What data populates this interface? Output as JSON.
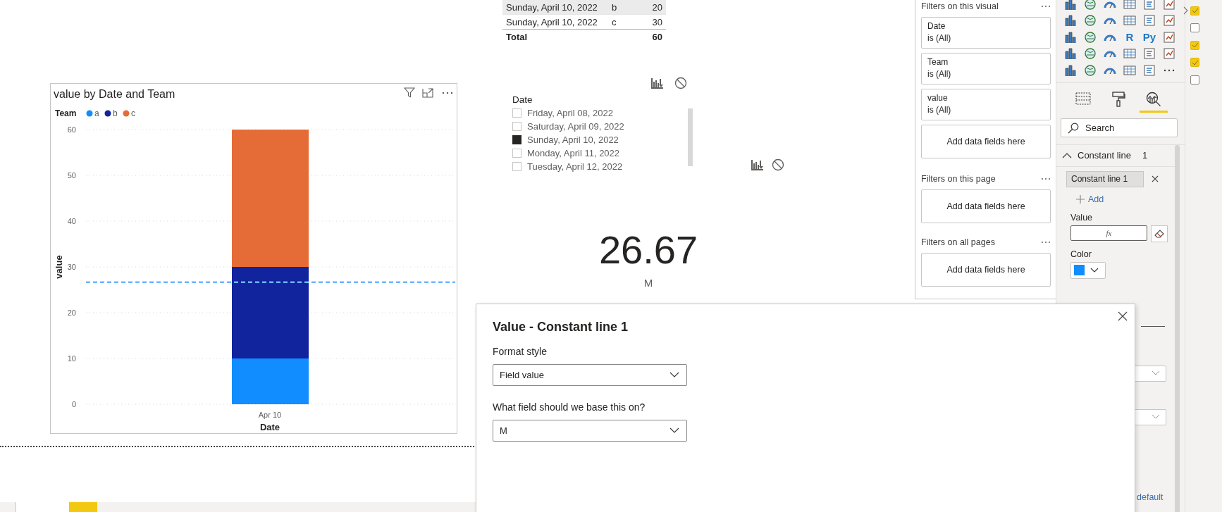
{
  "report": {
    "table": {
      "rows": [
        {
          "cells": [
            "Sunday, April 10, 2022",
            "b",
            "20"
          ],
          "selected": true
        },
        {
          "cells": [
            "Sunday, April 10, 2022",
            "c",
            "30"
          ],
          "selected": false
        }
      ],
      "total": [
        "Total",
        "60"
      ]
    },
    "slicer": {
      "title": "Date",
      "items": [
        {
          "label": "Friday, April 08, 2022",
          "checked": false
        },
        {
          "label": "Saturday, April 09, 2022",
          "checked": false
        },
        {
          "label": "Sunday, April 10, 2022",
          "checked": true
        },
        {
          "label": "Monday, April 11, 2022",
          "checked": false
        },
        {
          "label": "Tuesday, April 12, 2022",
          "checked": false
        }
      ]
    },
    "card": {
      "value": "26.67",
      "label": "M"
    },
    "chart": {
      "title": "value by Date and Team",
      "chart_data": {
        "type": "bar",
        "stacked": true,
        "grid": true,
        "legend": {
          "title": "Team"
        },
        "xlabel": "Date",
        "ylabel": "value",
        "categories": [
          "Apr 10"
        ],
        "series": [
          {
            "name": "a",
            "color": "#118dff",
            "values": [
              10
            ]
          },
          {
            "name": "b",
            "color": "#12239e",
            "values": [
              20
            ]
          },
          {
            "name": "c",
            "color": "#e66c37",
            "values": [
              30
            ]
          }
        ],
        "ylim": [
          0,
          60
        ],
        "yticks": [
          0,
          10,
          20,
          30,
          40,
          50,
          60
        ],
        "ref_lines": [
          {
            "axis": "y",
            "value": 26.67,
            "color": "#6cb6ff"
          }
        ]
      }
    },
    "page_tabs": [
      {
        "selected": false
      },
      {
        "selected": true
      }
    ]
  },
  "filters": {
    "sections": [
      {
        "title": "Filters on this visual",
        "cards": [
          {
            "field": "Date",
            "condition": "is (All)"
          },
          {
            "field": "Team",
            "condition": "is (All)"
          },
          {
            "field": "value",
            "condition": "is (All)"
          }
        ],
        "placeholder": "Add data fields here"
      },
      {
        "title": "Filters on this page",
        "placeholder": "Add data fields here"
      },
      {
        "title": "Filters on all pages",
        "placeholder": "Add data fields here"
      }
    ]
  },
  "visualizations": {
    "gallery": [
      {
        "kind": "icon"
      },
      {
        "kind": "icon"
      },
      {
        "kind": "icon"
      },
      {
        "kind": "icon"
      },
      {
        "kind": "icon"
      },
      {
        "kind": "icon"
      },
      {
        "kind": "icon"
      },
      {
        "kind": "icon"
      },
      {
        "kind": "icon"
      },
      {
        "kind": "icon"
      },
      {
        "kind": "icon"
      },
      {
        "kind": "icon"
      },
      {
        "kind": "icon"
      },
      {
        "kind": "icon"
      },
      {
        "kind": "icon"
      },
      {
        "kind": "letter",
        "text": "R"
      },
      {
        "kind": "letter",
        "text": "Py"
      },
      {
        "kind": "icon"
      },
      {
        "kind": "icon"
      },
      {
        "kind": "icon"
      },
      {
        "kind": "icon"
      },
      {
        "kind": "icon"
      },
      {
        "kind": "icon"
      },
      {
        "kind": "icon"
      },
      {
        "kind": "icon"
      },
      {
        "kind": "icon"
      },
      {
        "kind": "icon"
      },
      {
        "kind": "icon"
      },
      {
        "kind": "icon"
      },
      {
        "kind": "more"
      }
    ],
    "tabs": [
      {
        "kind": "fields",
        "selected": false
      },
      {
        "kind": "format",
        "selected": false
      },
      {
        "kind": "analytics",
        "selected": true
      }
    ],
    "search": {
      "placeholder": "Search"
    },
    "section": {
      "title": "Constant line",
      "count": "1",
      "expanded": true
    },
    "lines": [
      {
        "label": "Constant line 1"
      }
    ],
    "add": "Add",
    "value_label": "Value",
    "value_button": "fx",
    "color_label": "Color",
    "color": "#118dff",
    "reset_link": "default"
  },
  "fields": {
    "items": [
      {
        "checked": true
      },
      {
        "checked": false
      },
      {
        "checked": true
      },
      {
        "checked": true
      },
      {
        "checked": false
      }
    ]
  },
  "dialog": {
    "title": "Value - Constant line 1",
    "format_label": "Format style",
    "format_value": "Field value",
    "field_label": "What field should we base this on?",
    "field_value": "M"
  }
}
